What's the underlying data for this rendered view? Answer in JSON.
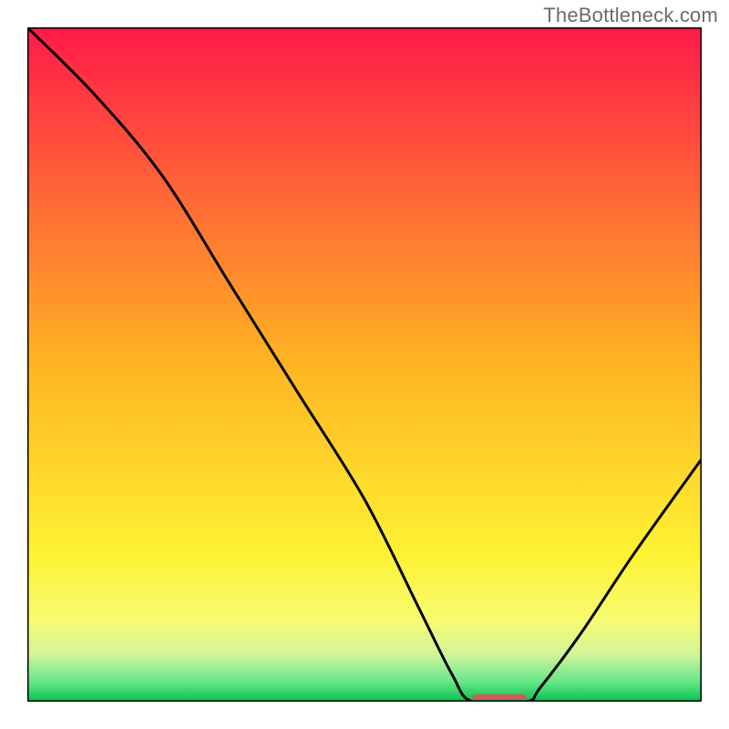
{
  "watermark": "TheBottleneck.com",
  "chart_data": {
    "type": "line",
    "title": "",
    "xlabel": "",
    "ylabel": "",
    "xlim": [
      0,
      100
    ],
    "ylim": [
      0,
      100
    ],
    "background_gradient": {
      "stops": [
        {
          "offset": 0.0,
          "color": "#ff1a49"
        },
        {
          "offset": 0.5,
          "color": "#ffb423"
        },
        {
          "offset": 0.78,
          "color": "#fef232"
        },
        {
          "offset": 0.88,
          "color": "#f7fb72"
        },
        {
          "offset": 0.93,
          "color": "#d2f49b"
        },
        {
          "offset": 0.97,
          "color": "#66e889"
        },
        {
          "offset": 1.0,
          "color": "#09c14d"
        }
      ]
    },
    "curve": {
      "description": "Bottleneck percentage curve; minimum (0%) at the notch.",
      "points_xy": [
        [
          0,
          100
        ],
        [
          10,
          90
        ],
        [
          20,
          78
        ],
        [
          30,
          62
        ],
        [
          40,
          46
        ],
        [
          50,
          30
        ],
        [
          58,
          14
        ],
        [
          63,
          4
        ],
        [
          66,
          0
        ],
        [
          74,
          0
        ],
        [
          76,
          2
        ],
        [
          82,
          10
        ],
        [
          90,
          22
        ],
        [
          100,
          36
        ]
      ]
    },
    "notch": {
      "x_start": 66,
      "x_end": 74,
      "bar_color": "#cd5d58",
      "bar_thickness": 6
    }
  }
}
